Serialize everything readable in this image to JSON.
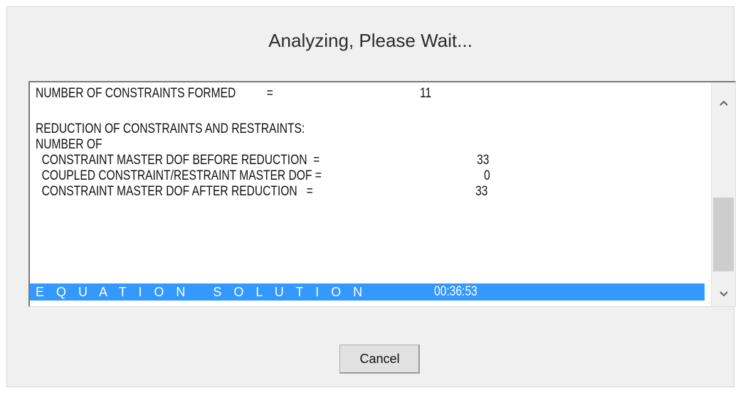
{
  "dialog": {
    "title": "Analyzing, Please Wait...",
    "cancel_label": "Cancel"
  },
  "log": {
    "lines": [
      {
        "text": "NUMBER OF CONSTRAINTS FORMED          =",
        "value": "11"
      },
      {
        "text": "",
        "value": ""
      },
      {
        "text": "REDUCTION OF CONSTRAINTS AND RESTRAINTS:",
        "value": ""
      },
      {
        "text": "NUMBER OF",
        "value": ""
      },
      {
        "text": "  CONSTRAINT MASTER DOF BEFORE REDUCTION  =",
        "value": "33"
      },
      {
        "text": "  COUPLED CONSTRAINT/RESTRAINT MASTER DOF =",
        "value": "0"
      },
      {
        "text": "  CONSTRAINT MASTER DOF AFTER REDUCTION   =",
        "value": "33"
      },
      {
        "text": "",
        "value": ""
      },
      {
        "text": "",
        "value": ""
      },
      {
        "text": "E Q U A T I O N   S O L U T I O N",
        "value": "00:36:53"
      }
    ],
    "selected_line": 9
  },
  "scrollbar": {
    "up_icon": "chevron-up-icon",
    "down_icon": "chevron-down-icon"
  },
  "colors": {
    "selection": "#3399ff",
    "dialog_bg": "#f0f0f0"
  }
}
